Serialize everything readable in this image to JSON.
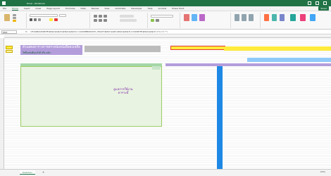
{
  "window": {
    "title": "Excel - Workbook"
  },
  "menu": {
    "items": [
      "File",
      "Home",
      "Insert",
      "Draw",
      "Page Layout",
      "Formulas",
      "Data",
      "Review",
      "View",
      "Automate",
      "Developer",
      "Help",
      "Acrobat",
      "Power Pivot"
    ],
    "active": "Home",
    "share_label": "Share"
  },
  "formula_bar": {
    "name_box": "M12",
    "fx": "fx",
    "formula": "=IF(AND(COUNTIF($D$4:$AI$13,$D$4:$AI$13)<>0,SUMPRODUCT(--EXACT($D$7:$AI$7,$D$4:$AI$13))=COUNTIF($D$4:$AI$13,\"x\")),\"x\",\"\")"
  },
  "sheet": {
    "left_title": "ตัวแสดงตารางการตรวจนับหนังสือคงเหลือ",
    "left_subtitle": "ใส่ชื่อหนังสือ/ครั้งที่ หรือ คลิก",
    "gray_label": "",
    "green_header": "",
    "green_small": "",
    "bubble_text": [
      "ดูแลการใช้งาน",
      "ตารางนี้"
    ],
    "lower_list": [],
    "footer_note": ""
  },
  "right_panel": {
    "red_banner": "",
    "title1": "",
    "title2": "",
    "blue_bar": "",
    "rows": []
  },
  "status": {
    "sheet_tab": "Prediction",
    "zoom": "100%"
  },
  "colors": {
    "excel_green": "#217346",
    "purple": "#b39ddb",
    "yellow": "#ffeb3b",
    "blue": "#1e88e5"
  }
}
